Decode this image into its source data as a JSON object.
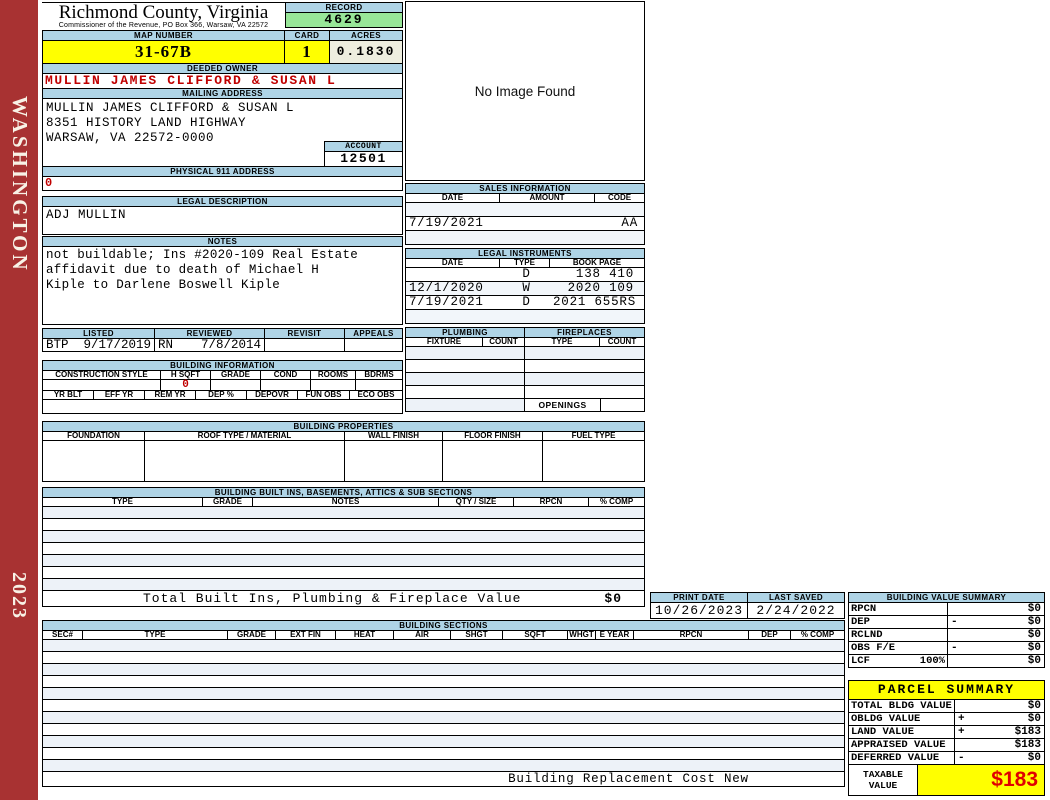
{
  "sidebar": {
    "district": "WASHINGTON",
    "year": "2023"
  },
  "header": {
    "title": "Richmond County, Virginia",
    "subtitle": "Commissioner of the Revenue, PO Box 366, Warsaw, VA 22572",
    "record_label": "RECORD",
    "record_value": "4629",
    "map_number_label": "MAP NUMBER",
    "map_number": "31-67B",
    "card_label": "CARD",
    "card": "1",
    "acres_label": "ACRES",
    "acres": "0.1830"
  },
  "owner": {
    "deeded_owner_label": "DEEDED OWNER",
    "deeded_owner": "MULLIN JAMES CLIFFORD & SUSAN L",
    "mailing_address_label": "MAILING ADDRESS",
    "mailing_line1": "MULLIN JAMES CLIFFORD & SUSAN L",
    "mailing_line2": "8351 HISTORY LAND HIGHWAY",
    "mailing_line3": "",
    "mailing_line4": "WARSAW, VA 22572-0000",
    "account_label": "ACCOUNT",
    "account": "12501",
    "physical_address_label": "PHYSICAL 911 ADDRESS",
    "physical_address": "0",
    "legal_description_label": "LEGAL DESCRIPTION",
    "legal_description": "ADJ MULLIN",
    "notes_label": "NOTES",
    "notes_line1": "not buildable; Ins #2020-109 Real Estate",
    "notes_line2": "affidavit due to death of Michael H",
    "notes_line3": "Kiple to Darlene Boswell Kiple"
  },
  "review": {
    "listed_label": "LISTED",
    "listed_by": "BTP",
    "listed_date": "9/17/2019",
    "reviewed_label": "REVIEWED",
    "reviewed_by": "RN",
    "reviewed_date": "7/8/2014",
    "revisit_label": "REVISIT",
    "revisit": "",
    "appeals_label": "APPEALS",
    "appeals": ""
  },
  "no_image": {
    "text": "No Image Found"
  },
  "sales": {
    "title": "SALES INFORMATION",
    "headers": [
      "DATE",
      "AMOUNT",
      "CODE"
    ],
    "rows": [
      [
        "",
        "",
        ""
      ],
      [
        "7/19/2021",
        "",
        "AA"
      ],
      [
        "",
        "",
        ""
      ]
    ]
  },
  "legal_instruments": {
    "title": "LEGAL INSTRUMENTS",
    "headers": [
      "DATE",
      "TYPE",
      "BOOK PAGE"
    ],
    "rows": [
      [
        "",
        "D",
        "138 410"
      ],
      [
        "12/1/2020",
        "W",
        "2020 109"
      ],
      [
        "7/19/2021",
        "D",
        "2021 655RS"
      ],
      [
        "",
        "",
        ""
      ]
    ]
  },
  "plumbing": {
    "title": "PLUMBING",
    "headers": [
      "FIXTURE",
      "COUNT"
    ]
  },
  "fireplaces": {
    "title": "FIREPLACES",
    "headers": [
      "TYPE",
      "COUNT"
    ],
    "openings_label": "OPENINGS"
  },
  "building_information": {
    "title": "BUILDING INFORMATION",
    "headers_row1": [
      "CONSTRUCTION STYLE",
      "H SQFT",
      "GRADE",
      "COND",
      "ROOMS",
      "BDRMS"
    ],
    "h_sqft_value": "0",
    "headers_row2": [
      "YR BLT",
      "EFF YR",
      "REM YR",
      "DEP %",
      "DEPOVR",
      "FUN OBS",
      "ECO OBS"
    ]
  },
  "building_properties": {
    "title": "BUILDING PROPERTIES",
    "headers": [
      "FOUNDATION",
      "ROOF TYPE / MATERIAL",
      "WALL FINISH",
      "FLOOR FINISH",
      "FUEL TYPE"
    ]
  },
  "built_ins": {
    "title": "BUILDING BUILT INS, BASEMENTS, ATTICS & SUB SECTIONS",
    "headers": [
      "TYPE",
      "GRADE",
      "NOTES",
      "QTY / SIZE",
      "RPCN",
      "% COMP"
    ],
    "total_label": "Total Built Ins, Plumbing & Fireplace Value",
    "total_value": "$0"
  },
  "print_info": {
    "print_date_label": "PRINT DATE",
    "print_date": "10/26/2023",
    "last_saved_label": "LAST SAVED",
    "last_saved": "2/24/2022"
  },
  "building_value_summary": {
    "title": "BUILDING VALUE SUMMARY",
    "rows": [
      {
        "label": "RPCN",
        "op": "",
        "value": "$0"
      },
      {
        "label": "DEP",
        "op": "-",
        "value": "$0"
      },
      {
        "label": "RCLND",
        "op": "",
        "value": "$0"
      },
      {
        "label": "OBS F/E",
        "op": "-",
        "value": "$0"
      },
      {
        "label": "LCF",
        "pct": "100%",
        "op": "",
        "value": "$0"
      }
    ]
  },
  "building_sections": {
    "title": "BUILDING SECTIONS",
    "headers": [
      "SEC#",
      "TYPE",
      "GRADE",
      "EXT FIN",
      "HEAT",
      "AIR",
      "SHGT",
      "SQFT",
      "WHGT",
      "E YEAR",
      "RPCN",
      "DEP",
      "% COMP"
    ],
    "footer": "Building Replacement Cost New"
  },
  "parcel_summary": {
    "title": "PARCEL SUMMARY",
    "rows": [
      {
        "label": "TOTAL BLDG VALUE",
        "op": "",
        "value": "$0"
      },
      {
        "label": "OBLDG VALUE",
        "op": "+",
        "value": "$0"
      },
      {
        "label": "LAND VALUE",
        "op": "+",
        "value": "$183"
      },
      {
        "label": "APPRAISED VALUE",
        "op": "",
        "value": "$183"
      },
      {
        "label": "DEFERRED VALUE",
        "op": "-",
        "value": "$0"
      }
    ],
    "taxable_label": "TAXABLE\nVALUE",
    "taxable_value": "$183"
  },
  "colors": {
    "header_blue": "#AFD4E6",
    "record_green": "#98E698",
    "highlight_yellow": "#FFFF00",
    "acres_cream": "#EEEEDF",
    "sidebar_red": "#A83232",
    "accent_red": "#C00000"
  }
}
